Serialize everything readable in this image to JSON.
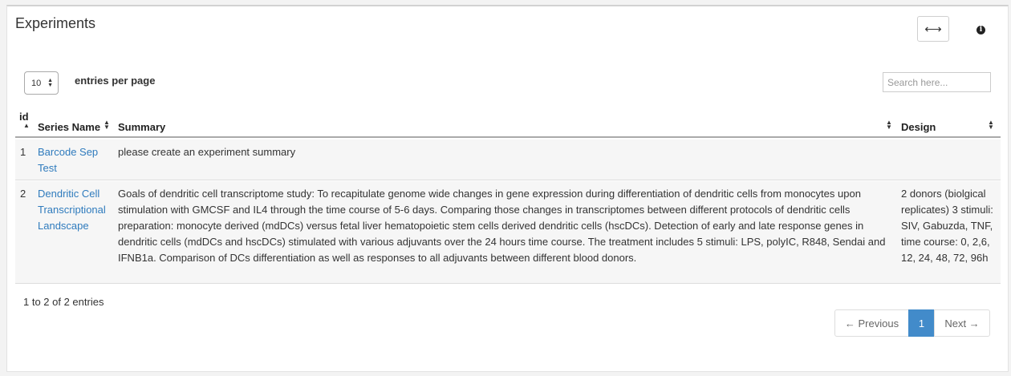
{
  "panel": {
    "title": "Experiments",
    "expand_symbol": "⟷",
    "info_symbol": "i"
  },
  "controls": {
    "per_page_value": "10",
    "per_page_label": "entries per page",
    "search_placeholder": "Search here..."
  },
  "table": {
    "columns": [
      {
        "label": "id"
      },
      {
        "label": "Series Name"
      },
      {
        "label": "Summary"
      },
      {
        "label": "Design"
      }
    ],
    "rows": [
      {
        "id": "1",
        "series_name": "Barcode Sep Test",
        "summary": "please create an experiment summary",
        "design": ""
      },
      {
        "id": "2",
        "series_name": "Dendritic Cell Transcriptional Landscape",
        "summary": "Goals of dendritic cell transcriptome study: To recapitulate genome wide changes in gene expression during differentiation of dendritic cells from monocytes upon stimulation with GMCSF and IL4 through the time course of 5-6 days. Comparing those changes in transcriptomes between different protocols of dendritic cells preparation: monocyte derived (mdDCs) versus fetal liver hematopoietic stem cells derived dendritic cells (hscDCs). Detection of early and late response genes in dendritic cells (mdDCs and hscDCs) stimulated with various adjuvants over the 24 hours time course. The treatment includes 5 stimuli: LPS, polyIC, R848, Sendai and IFNB1a. Comparison of DCs differentiation as well as responses to all adjuvants between different blood donors.",
        "design": "2 donors (biolgical replicates) 3 stimuli: SIV, Gabuzda, TNF, time course: 0, 2,6, 12, 24, 48, 72, 96h"
      }
    ]
  },
  "footer": {
    "info": "1 to 2 of 2 entries",
    "previous": "← Previous",
    "current_page": "1",
    "next": "Next →"
  }
}
